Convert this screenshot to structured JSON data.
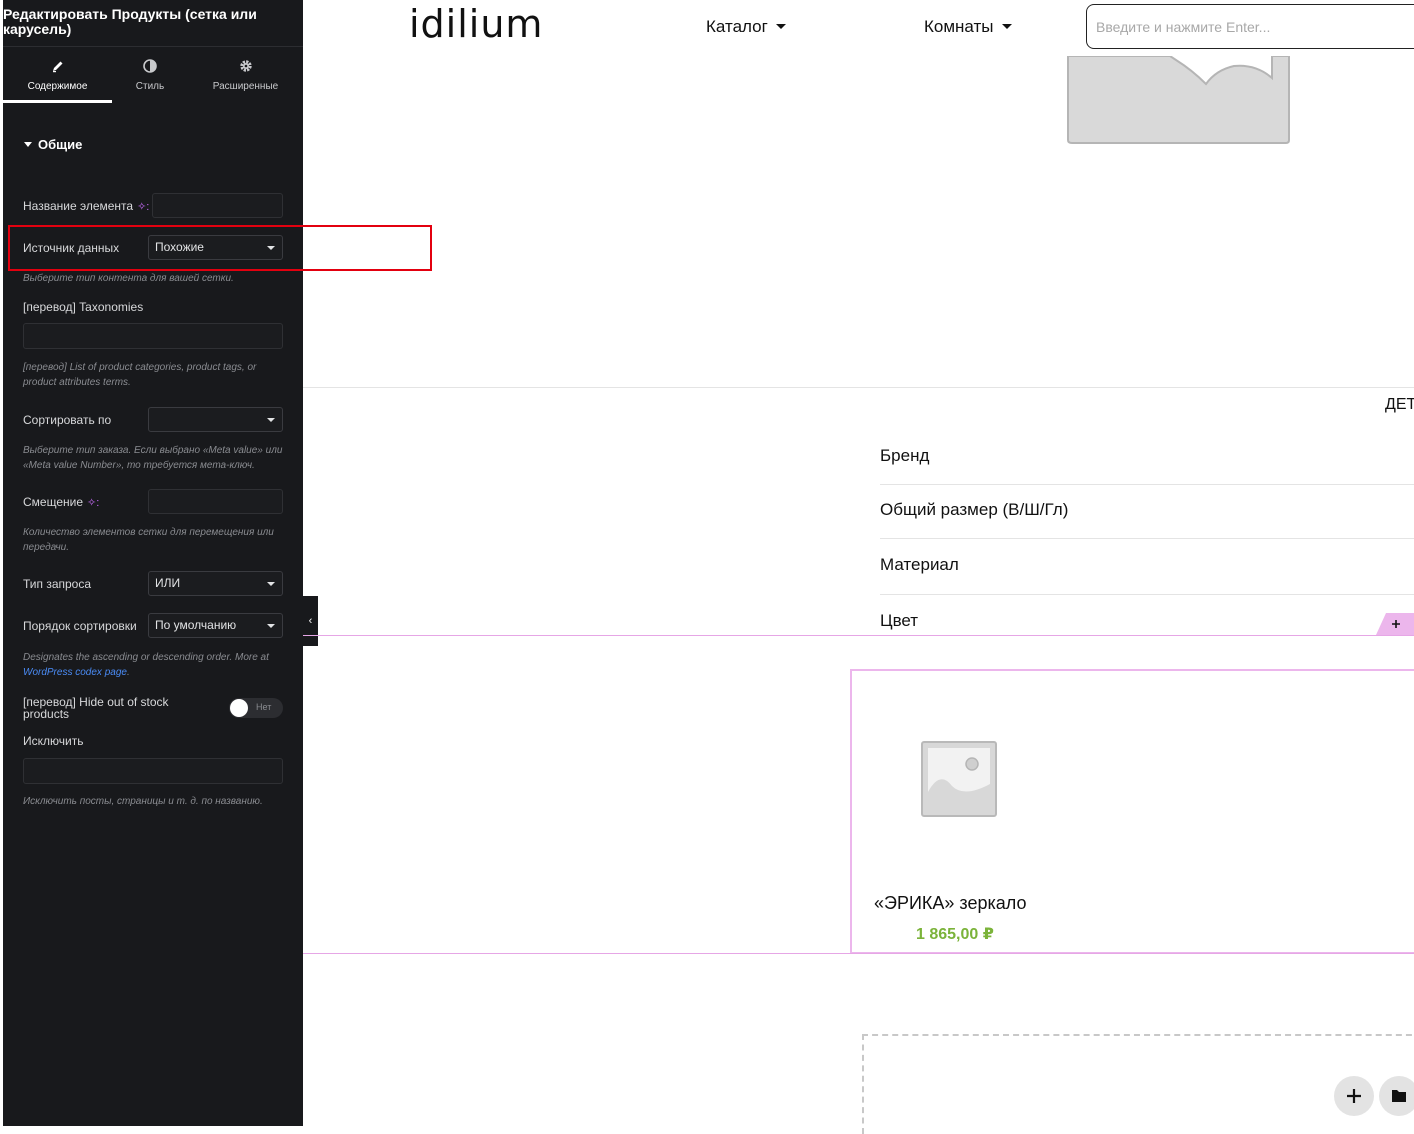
{
  "panel": {
    "title": "Редактировать Продукты (сетка или карусель)",
    "tabs": [
      {
        "label": "Содержимое",
        "icon": "pencil-icon"
      },
      {
        "label": "Стиль",
        "icon": "contrast-icon"
      },
      {
        "label": "Расширенные",
        "icon": "gear-icon"
      }
    ],
    "section": "Общие",
    "fields": {
      "element_name_label": "Название элемента",
      "data_source_label": "Источник данных",
      "data_source_value": "Похожие",
      "data_source_help": "Выберите тип контента для вашей сетки.",
      "taxonomies_label": "[перевод] Taxonomies",
      "taxonomies_help": "[перевод] List of product categories, product tags, or product attributes terms.",
      "order_by_label": "Сортировать по",
      "order_by_value": "",
      "order_by_help": "Выберите тип заказа. Если выбрано «Meta value» или «Meta value Number», то требуется мета-ключ.",
      "offset_label": "Смещение",
      "offset_help": "Количество элементов сетки для перемещения или передачи.",
      "query_type_label": "Тип запроса",
      "query_type_value": "ИЛИ",
      "sort_order_label": "Порядок сортировки",
      "sort_order_value": "По умолчанию",
      "sort_order_help_prefix": "Designates the ascending or descending order. More at ",
      "sort_order_help_link": "WordPress codex page",
      "sort_order_help_suffix": ".",
      "hide_oos_label": "[перевод] Hide out of stock products",
      "hide_oos_value": "Нет",
      "exclude_label": "Исключить",
      "exclude_help": "Исключить посты, страницы и т. д. по названию."
    }
  },
  "site": {
    "logo": "idilium",
    "nav": [
      "Каталог",
      "Комнаты"
    ],
    "search_placeholder": "Введите и нажмите Enter...",
    "details_label": "ДЕТ",
    "specs": [
      "Бренд",
      "Общий размер (В/Ш/Гл)",
      "Материал",
      "Цвет"
    ],
    "product": {
      "title": "«ЭРИКА» зеркало",
      "price": "1 865,00 ₽"
    }
  },
  "colors": {
    "panel_bg": "#18191c",
    "highlight": "#e3000f",
    "price": "#7bb33a",
    "editor_pink": "#e6a6e6"
  }
}
